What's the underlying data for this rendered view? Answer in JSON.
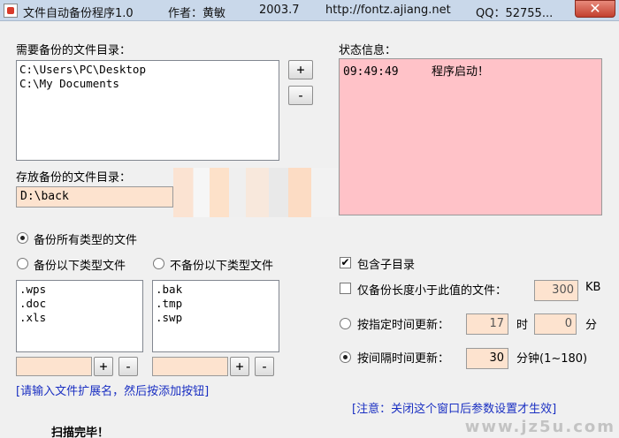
{
  "window": {
    "title": "文件自动备份程序1.0",
    "author": "作者：黄敏",
    "year": "2003.7",
    "url": "http://fontz.ajiang.net",
    "qq": "QQ：52755...",
    "close_glyph": "✕"
  },
  "source_dirs": {
    "label": "需要备份的文件目录：",
    "items": [
      "C:\\Users\\PC\\Desktop",
      "C:\\My Documents"
    ],
    "add_label": "+",
    "remove_label": "-"
  },
  "status": {
    "label": "状态信息：",
    "entries": [
      {
        "time": "09:49:49",
        "message": "程序启动！"
      }
    ]
  },
  "backup_dir": {
    "label": "存放备份的文件目录：",
    "value": "D:\\back"
  },
  "file_types": {
    "all_label": "备份所有类型的文件",
    "include_label": "备份以下类型文件",
    "exclude_label": "不备份以下类型文件",
    "include_list": [
      ".wps",
      ".doc",
      ".xls"
    ],
    "exclude_list": [
      ".bak",
      ".tmp",
      ".swp"
    ],
    "add_label": "+",
    "remove_label": "-",
    "hint": "[请输入文件扩展名，然后按添加按钮]"
  },
  "options": {
    "subdir_label": "包含子目录",
    "size_label": "仅备份长度小于此值的文件：",
    "size_value": "300",
    "size_unit": "KB",
    "fixed_time_label": "按指定时间更新：",
    "hour_value": "17",
    "hour_unit": "时",
    "minute_value": "0",
    "minute_unit": "分",
    "interval_label": "按间隔时间更新：",
    "interval_value": "30",
    "interval_unit": "分钟(1~180)"
  },
  "notice": "[注意：关闭这个窗口后参数设置才生效]",
  "scan_status": "扫描完毕！",
  "watermark": "www.jz5u.com"
}
